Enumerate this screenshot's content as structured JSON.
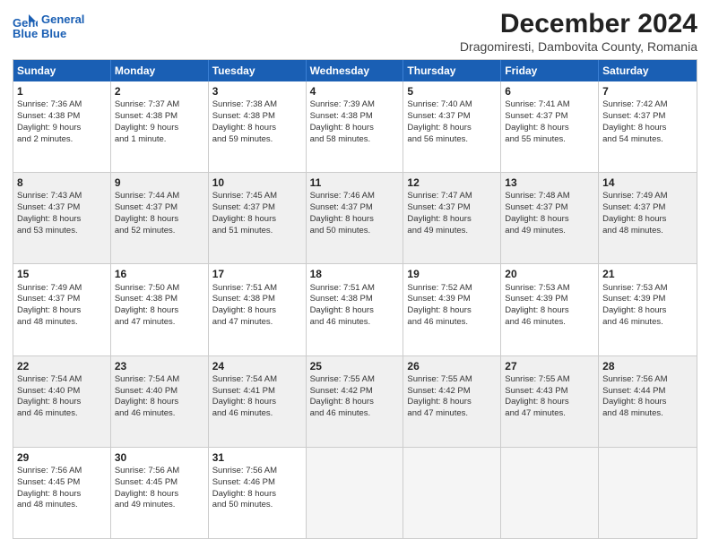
{
  "header": {
    "logo_line1": "General",
    "logo_line2": "Blue",
    "title": "December 2024",
    "subtitle": "Dragomiresti, Dambovita County, Romania"
  },
  "days_of_week": [
    "Sunday",
    "Monday",
    "Tuesday",
    "Wednesday",
    "Thursday",
    "Friday",
    "Saturday"
  ],
  "weeks": [
    [
      {
        "day": "1",
        "info": "Sunrise: 7:36 AM\nSunset: 4:38 PM\nDaylight: 9 hours\nand 2 minutes."
      },
      {
        "day": "2",
        "info": "Sunrise: 7:37 AM\nSunset: 4:38 PM\nDaylight: 9 hours\nand 1 minute."
      },
      {
        "day": "3",
        "info": "Sunrise: 7:38 AM\nSunset: 4:38 PM\nDaylight: 8 hours\nand 59 minutes."
      },
      {
        "day": "4",
        "info": "Sunrise: 7:39 AM\nSunset: 4:38 PM\nDaylight: 8 hours\nand 58 minutes."
      },
      {
        "day": "5",
        "info": "Sunrise: 7:40 AM\nSunset: 4:37 PM\nDaylight: 8 hours\nand 56 minutes."
      },
      {
        "day": "6",
        "info": "Sunrise: 7:41 AM\nSunset: 4:37 PM\nDaylight: 8 hours\nand 55 minutes."
      },
      {
        "day": "7",
        "info": "Sunrise: 7:42 AM\nSunset: 4:37 PM\nDaylight: 8 hours\nand 54 minutes."
      }
    ],
    [
      {
        "day": "8",
        "info": "Sunrise: 7:43 AM\nSunset: 4:37 PM\nDaylight: 8 hours\nand 53 minutes."
      },
      {
        "day": "9",
        "info": "Sunrise: 7:44 AM\nSunset: 4:37 PM\nDaylight: 8 hours\nand 52 minutes."
      },
      {
        "day": "10",
        "info": "Sunrise: 7:45 AM\nSunset: 4:37 PM\nDaylight: 8 hours\nand 51 minutes."
      },
      {
        "day": "11",
        "info": "Sunrise: 7:46 AM\nSunset: 4:37 PM\nDaylight: 8 hours\nand 50 minutes."
      },
      {
        "day": "12",
        "info": "Sunrise: 7:47 AM\nSunset: 4:37 PM\nDaylight: 8 hours\nand 49 minutes."
      },
      {
        "day": "13",
        "info": "Sunrise: 7:48 AM\nSunset: 4:37 PM\nDaylight: 8 hours\nand 49 minutes."
      },
      {
        "day": "14",
        "info": "Sunrise: 7:49 AM\nSunset: 4:37 PM\nDaylight: 8 hours\nand 48 minutes."
      }
    ],
    [
      {
        "day": "15",
        "info": "Sunrise: 7:49 AM\nSunset: 4:37 PM\nDaylight: 8 hours\nand 48 minutes."
      },
      {
        "day": "16",
        "info": "Sunrise: 7:50 AM\nSunset: 4:38 PM\nDaylight: 8 hours\nand 47 minutes."
      },
      {
        "day": "17",
        "info": "Sunrise: 7:51 AM\nSunset: 4:38 PM\nDaylight: 8 hours\nand 47 minutes."
      },
      {
        "day": "18",
        "info": "Sunrise: 7:51 AM\nSunset: 4:38 PM\nDaylight: 8 hours\nand 46 minutes."
      },
      {
        "day": "19",
        "info": "Sunrise: 7:52 AM\nSunset: 4:39 PM\nDaylight: 8 hours\nand 46 minutes."
      },
      {
        "day": "20",
        "info": "Sunrise: 7:53 AM\nSunset: 4:39 PM\nDaylight: 8 hours\nand 46 minutes."
      },
      {
        "day": "21",
        "info": "Sunrise: 7:53 AM\nSunset: 4:39 PM\nDaylight: 8 hours\nand 46 minutes."
      }
    ],
    [
      {
        "day": "22",
        "info": "Sunrise: 7:54 AM\nSunset: 4:40 PM\nDaylight: 8 hours\nand 46 minutes."
      },
      {
        "day": "23",
        "info": "Sunrise: 7:54 AM\nSunset: 4:40 PM\nDaylight: 8 hours\nand 46 minutes."
      },
      {
        "day": "24",
        "info": "Sunrise: 7:54 AM\nSunset: 4:41 PM\nDaylight: 8 hours\nand 46 minutes."
      },
      {
        "day": "25",
        "info": "Sunrise: 7:55 AM\nSunset: 4:42 PM\nDaylight: 8 hours\nand 46 minutes."
      },
      {
        "day": "26",
        "info": "Sunrise: 7:55 AM\nSunset: 4:42 PM\nDaylight: 8 hours\nand 47 minutes."
      },
      {
        "day": "27",
        "info": "Sunrise: 7:55 AM\nSunset: 4:43 PM\nDaylight: 8 hours\nand 47 minutes."
      },
      {
        "day": "28",
        "info": "Sunrise: 7:56 AM\nSunset: 4:44 PM\nDaylight: 8 hours\nand 48 minutes."
      }
    ],
    [
      {
        "day": "29",
        "info": "Sunrise: 7:56 AM\nSunset: 4:45 PM\nDaylight: 8 hours\nand 48 minutes."
      },
      {
        "day": "30",
        "info": "Sunrise: 7:56 AM\nSunset: 4:45 PM\nDaylight: 8 hours\nand 49 minutes."
      },
      {
        "day": "31",
        "info": "Sunrise: 7:56 AM\nSunset: 4:46 PM\nDaylight: 8 hours\nand 50 minutes."
      },
      {
        "day": "",
        "info": ""
      },
      {
        "day": "",
        "info": ""
      },
      {
        "day": "",
        "info": ""
      },
      {
        "day": "",
        "info": ""
      }
    ]
  ]
}
